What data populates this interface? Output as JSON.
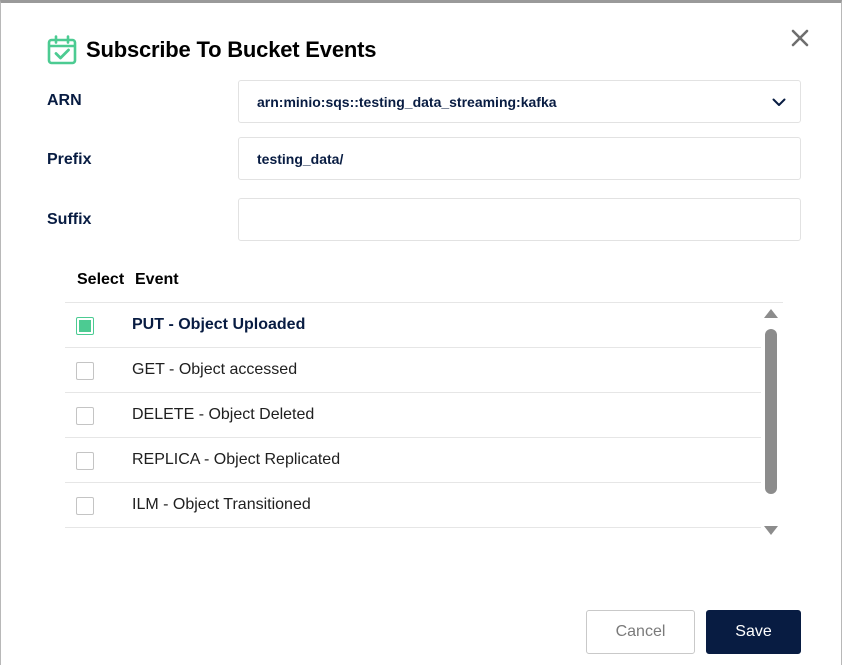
{
  "dialog": {
    "title": "Subscribe To Bucket Events",
    "icon": "calendar-check-icon",
    "accent_color": "#4ccb92",
    "primary_color": "#081c42"
  },
  "form": {
    "arn": {
      "label": "ARN",
      "value": "arn:minio:sqs::testing_data_streaming:kafka"
    },
    "prefix": {
      "label": "Prefix",
      "value": "testing_data/"
    },
    "suffix": {
      "label": "Suffix",
      "value": ""
    }
  },
  "events_table": {
    "headers": {
      "select": "Select",
      "event": "Event"
    },
    "rows": [
      {
        "label": "PUT - Object Uploaded",
        "checked": true
      },
      {
        "label": "GET - Object accessed",
        "checked": false
      },
      {
        "label": "DELETE - Object Deleted",
        "checked": false
      },
      {
        "label": "REPLICA - Object Replicated",
        "checked": false
      },
      {
        "label": "ILM - Object Transitioned",
        "checked": false
      }
    ]
  },
  "actions": {
    "cancel_label": "Cancel",
    "save_label": "Save"
  }
}
